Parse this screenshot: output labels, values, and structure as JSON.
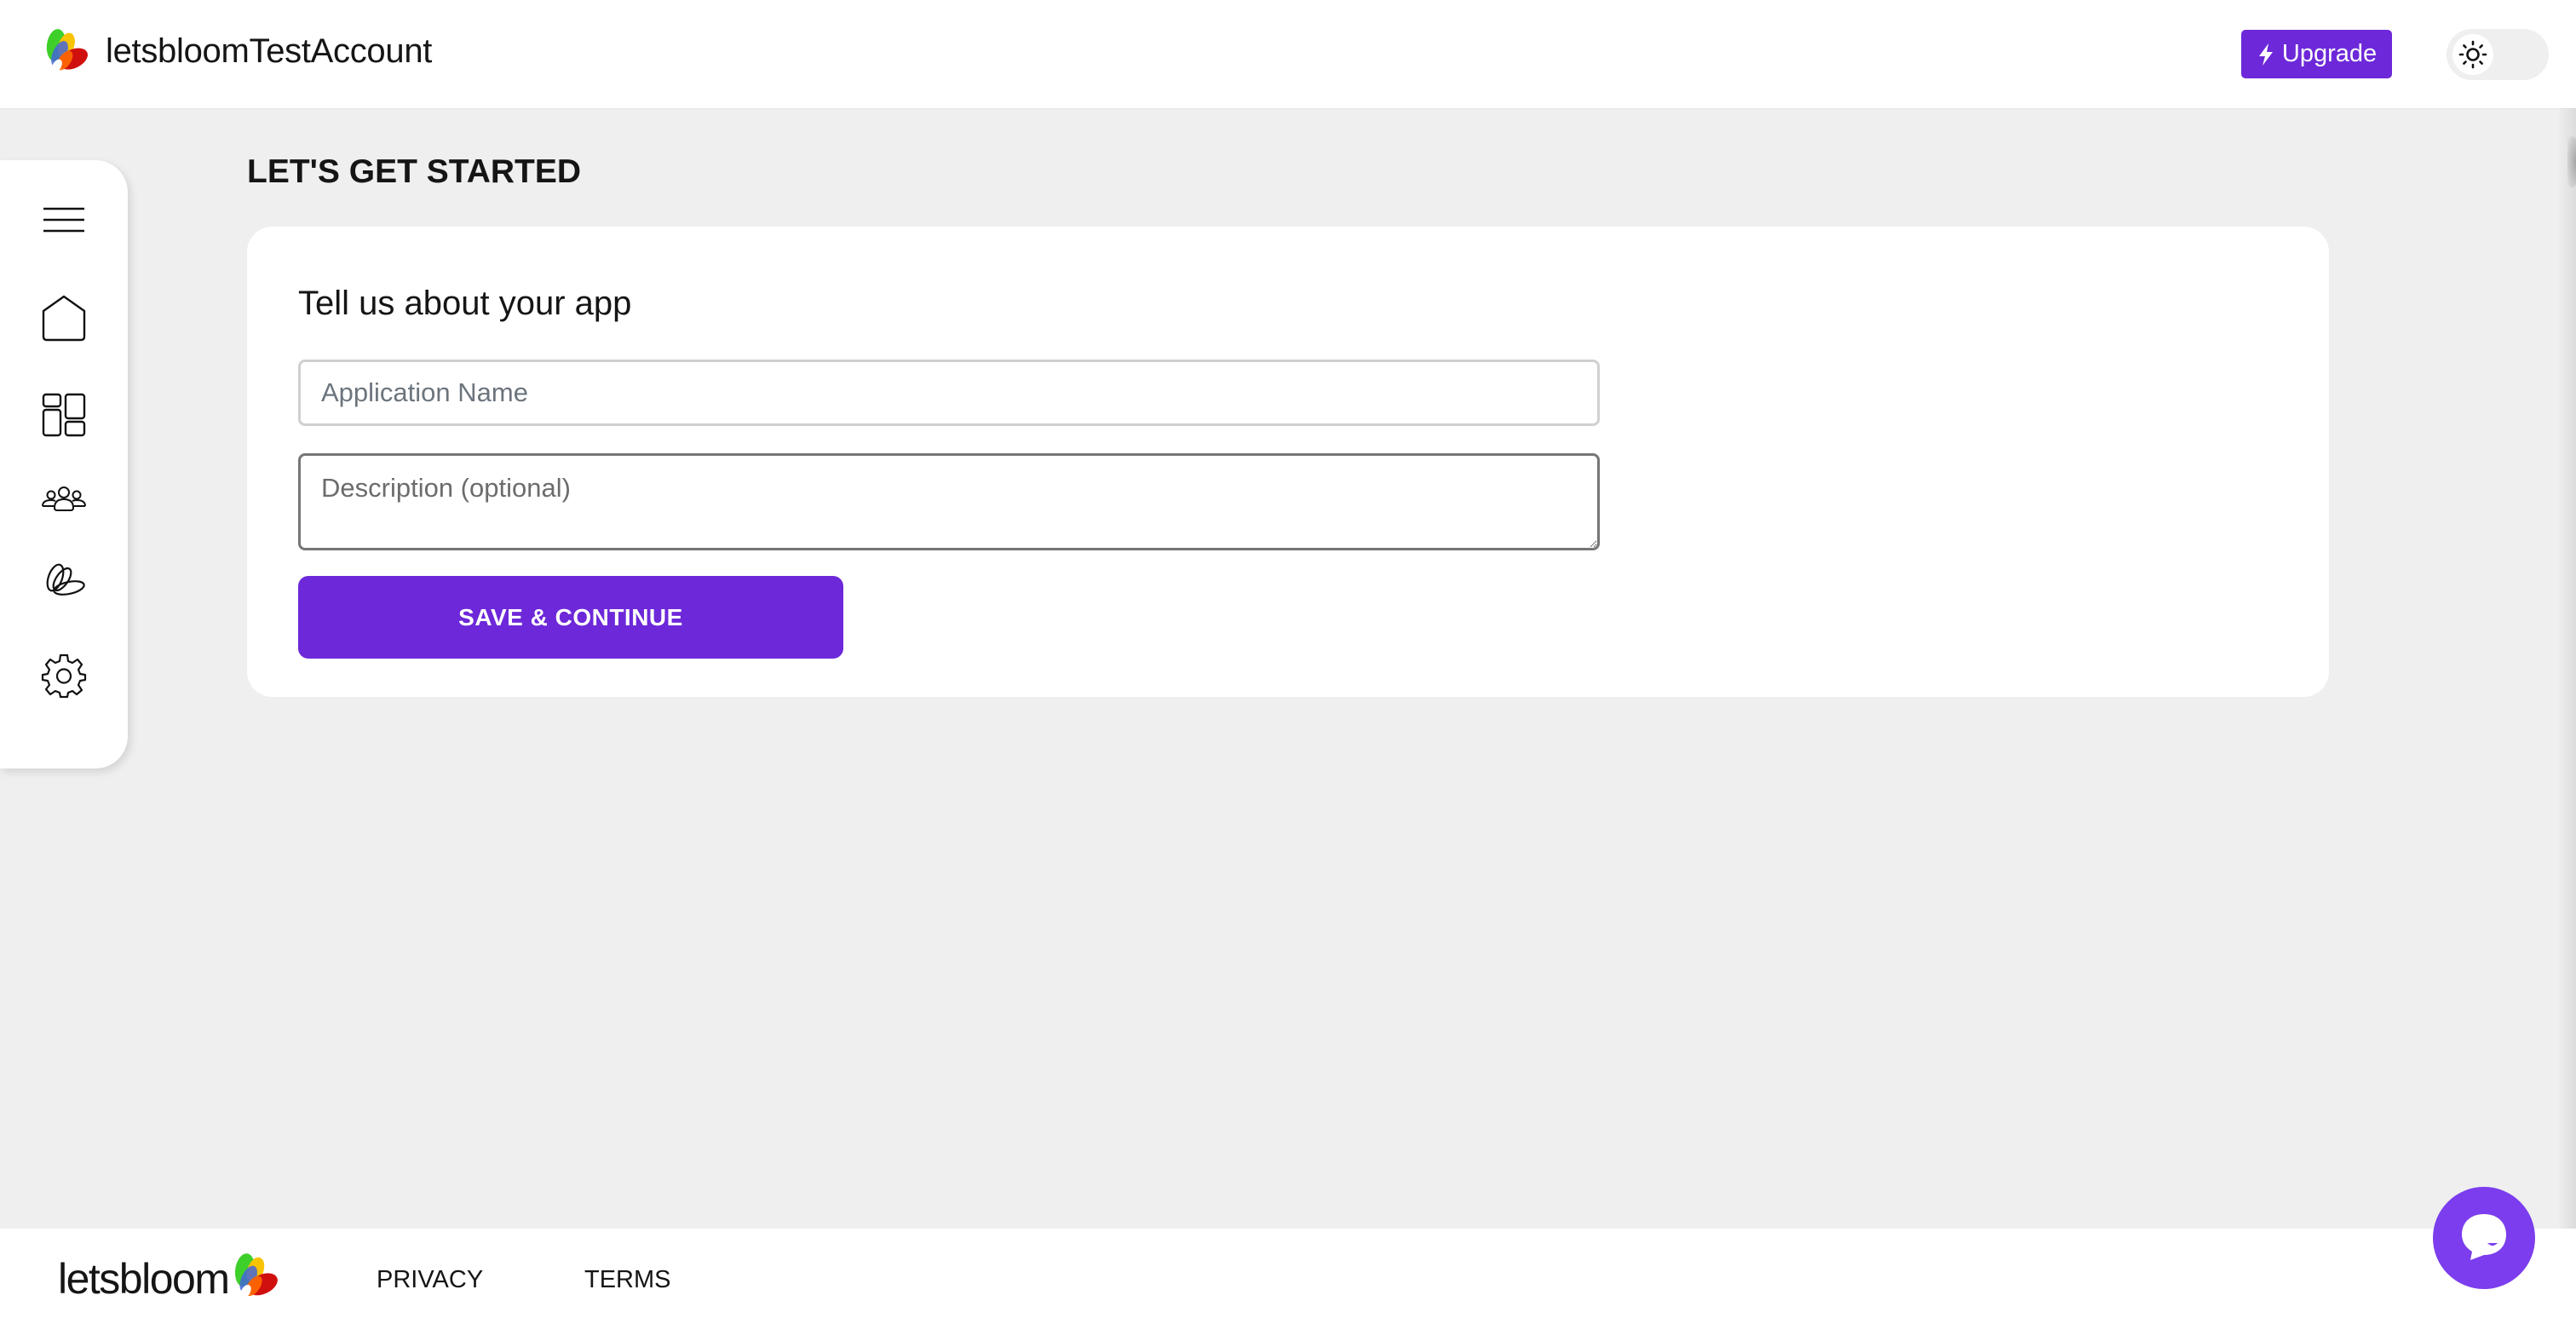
{
  "header": {
    "account_name": "letsbloomTestAccount",
    "logo_icon": "letsbloom-petal-logo",
    "upgrade_label": "Upgrade",
    "upgrade_icon": "lightning-bolt-icon",
    "theme_toggle_icon": "sun-icon",
    "theme_mode": "light"
  },
  "sidebar": {
    "items": [
      {
        "name": "menu",
        "icon": "hamburger-menu-icon"
      },
      {
        "name": "home",
        "icon": "home-icon"
      },
      {
        "name": "dashboard",
        "icon": "dashboard-grid-icon"
      },
      {
        "name": "users",
        "icon": "users-group-icon"
      },
      {
        "name": "bloom",
        "icon": "bloom-petals-icon"
      },
      {
        "name": "settings",
        "icon": "gear-icon"
      }
    ]
  },
  "main": {
    "page_title": "LET'S GET STARTED",
    "card": {
      "title": "Tell us about your app",
      "app_name": {
        "value": "",
        "placeholder": "Application Name"
      },
      "description": {
        "value": "",
        "placeholder": "Description (optional)"
      },
      "save_label": "SAVE & CONTINUE"
    }
  },
  "footer": {
    "logo_text": "letsbloom",
    "links": [
      "PRIVACY",
      "TERMS"
    ]
  },
  "chat": {
    "icon": "chat-bubble-icon"
  },
  "colors": {
    "accent": "#6d28d9",
    "chat": "#7b3ded",
    "background": "#efefef"
  }
}
